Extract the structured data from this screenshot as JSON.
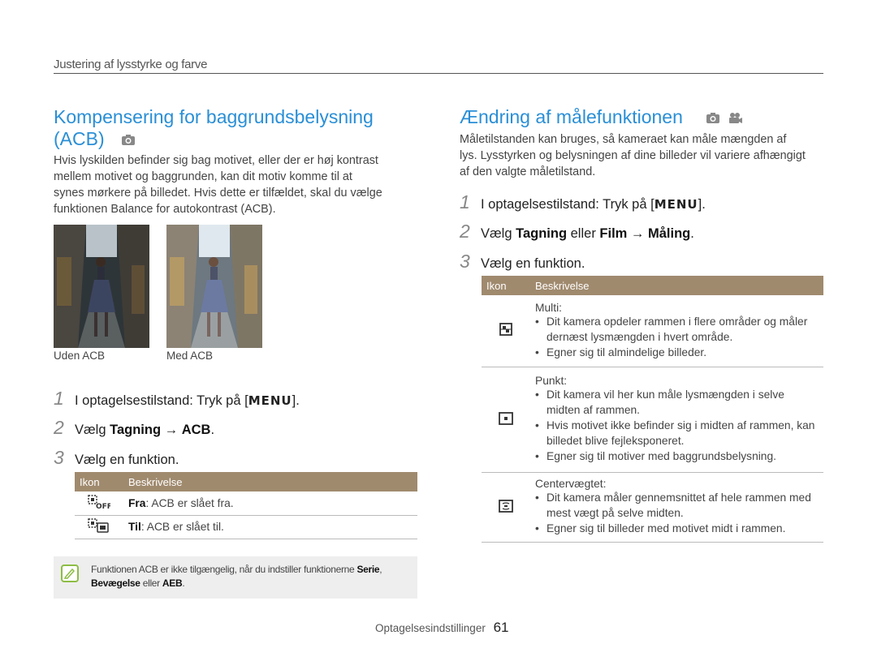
{
  "header": {
    "section_title": "Justering af lysstyrke og farve"
  },
  "left": {
    "title_line1": "Kompensering for baggrundsbelysning",
    "title_line2": "(ACB)",
    "mode_icons": [
      "camera-icon"
    ],
    "intro": [
      "Hvis lyskilden befinder sig bag motivet, eller der er høj kontrast",
      "mellem motivet og baggrunden, kan dit motiv komme til at",
      "synes mørkere på billedet. Hvis dette er tilfældet, skal du vælge",
      "funktionen Balance for autokontrast (ACB)."
    ],
    "photos": [
      {
        "caption": "Uden ACB"
      },
      {
        "caption": "Med ACB"
      }
    ],
    "steps": [
      {
        "num": "1",
        "text_pre": "I optagelsestilstand: Tryk på [",
        "key": "MENU",
        "text_post": "]."
      },
      {
        "num": "2",
        "text_pre": "Vælg ",
        "bold1": "Tagning",
        "arrow": " → ",
        "bold2": "ACB",
        "text_post": "."
      },
      {
        "num": "3",
        "text": "Vælg en funktion."
      }
    ],
    "table": {
      "headers": [
        "Ikon",
        "Beskrivelse"
      ],
      "rows": [
        {
          "icon": "acb-off-icon",
          "name": "Fra",
          "desc": ": ACB er slået fra."
        },
        {
          "icon": "acb-on-icon",
          "name": "Til",
          "desc": ": ACB er slået til."
        }
      ]
    },
    "note": {
      "text1": "Funktionen ACB er ikke tilgængelig, når du indstiller funktionerne ",
      "bold1": "Serie",
      "sep": ",",
      "bold2": "Bevægelse",
      "text2": " eller ",
      "bold3": "AEB",
      "end": "."
    }
  },
  "right": {
    "title": "Ændring af målefunktionen",
    "mode_icons": [
      "camera-icon",
      "video-camera-icon"
    ],
    "intro": [
      "Måletilstanden kan bruges, så kameraet kan måle mængden af",
      "lys. Lysstyrken og belysningen af dine billeder vil variere afhængigt",
      "af den valgte måletilstand."
    ],
    "steps": [
      {
        "num": "1",
        "text_pre": "I optagelsestilstand: Tryk på [",
        "key": "MENU",
        "text_post": "]."
      },
      {
        "num": "2",
        "text_pre": "Vælg ",
        "bold1": "Tagning",
        "mid": " eller ",
        "bold2": "Film",
        "arrow": " → ",
        "bold3": "Måling",
        "text_post": "."
      },
      {
        "num": "3",
        "text": "Vælg en funktion."
      }
    ],
    "table": {
      "headers": [
        "Ikon",
        "Beskrivelse"
      ],
      "rows": [
        {
          "icon": "multi-metering-icon",
          "name": "Multi",
          "bullets": [
            "Dit kamera opdeler rammen i flere områder og måler dernæst lysmængden i hvert område.",
            "Egner sig til almindelige billeder."
          ]
        },
        {
          "icon": "spot-metering-icon",
          "name": "Punkt",
          "bullets": [
            "Dit kamera vil her kun måle lysmængden i selve midten af rammen.",
            "Hvis motivet ikke befinder sig i midten af rammen, kan billedet blive fejleksponeret.",
            "Egner sig til motiver med baggrundsbelysning."
          ]
        },
        {
          "icon": "center-weighted-metering-icon",
          "name": "Centervægtet",
          "bullets": [
            "Dit kamera måler gennemsnittet af hele rammen med mest vægt på selve midten.",
            "Egner sig til billeder med motivet midt i rammen."
          ]
        }
      ]
    }
  },
  "footer": {
    "label": "Optagelsesindstillinger",
    "page": "61"
  },
  "colors": {
    "heading": "#2a8fd6",
    "table_header": "#a08a6e",
    "note_bg": "#eeeeee",
    "note_icon": "#8dbd44"
  }
}
